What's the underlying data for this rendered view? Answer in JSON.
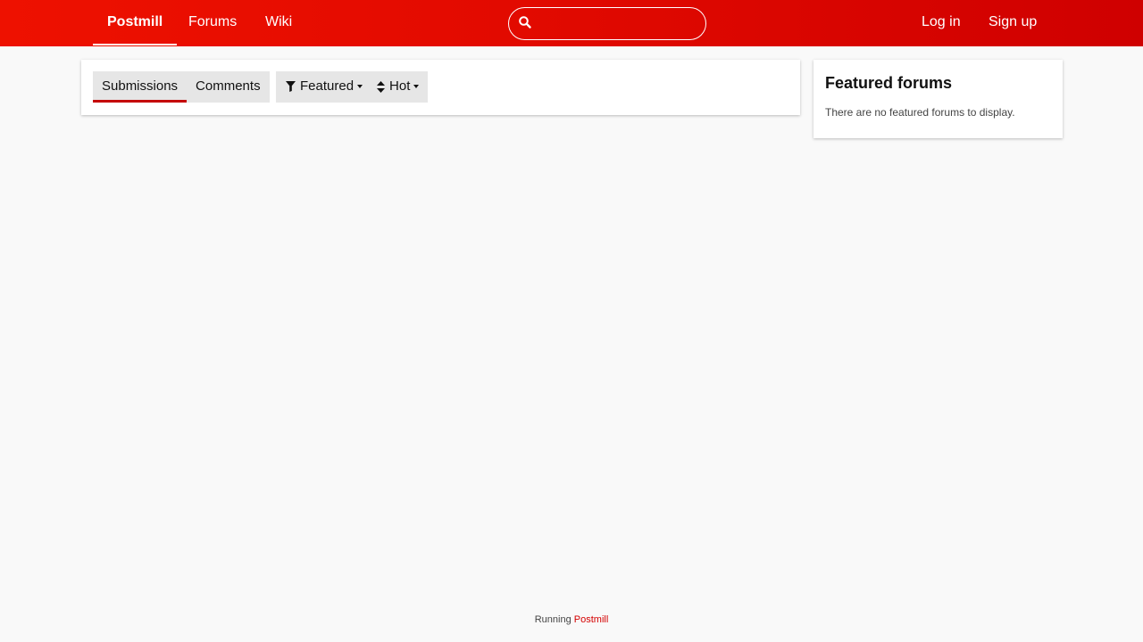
{
  "nav": {
    "brand": "Postmill",
    "forums": "Forums",
    "wiki": "Wiki",
    "login": "Log in",
    "signup": "Sign up",
    "search_value": ""
  },
  "main": {
    "tabs": [
      {
        "label": "Submissions",
        "active": true
      },
      {
        "label": "Comments",
        "active": false
      }
    ],
    "filter_label": "Featured",
    "sort_label": "Hot"
  },
  "sidebar": {
    "title": "Featured forums",
    "empty_text": "There are no featured forums to display."
  },
  "footer": {
    "prefix": "Running",
    "link": "Postmill"
  },
  "colors": {
    "brand_red": "#e20a00",
    "accent_underline": "#c40000",
    "footer_link": "#d40000"
  },
  "icons": [
    "search-icon",
    "filter-icon",
    "sort-icon",
    "chevron-down-icon"
  ]
}
